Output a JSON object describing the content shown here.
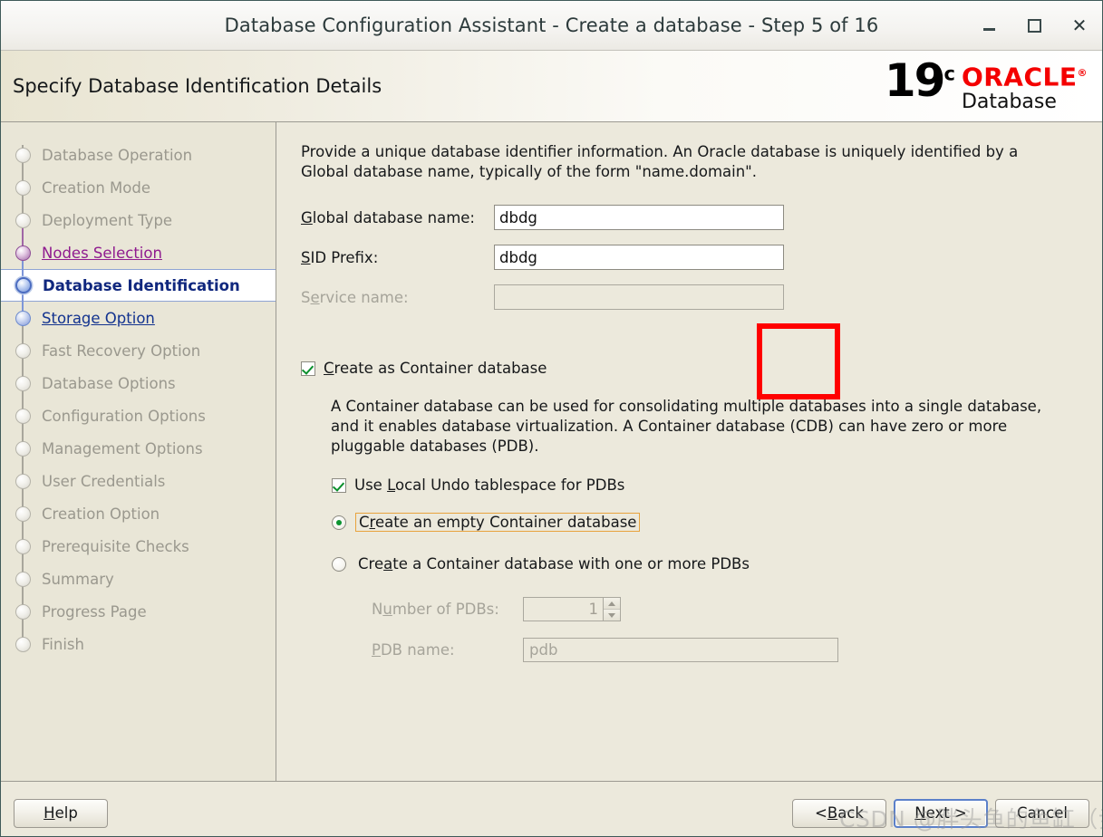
{
  "window": {
    "title": "Database Configuration Assistant - Create a database - Step 5 of 16",
    "minimize_label": "–",
    "maximize_label": "□",
    "close_label": "×"
  },
  "header": {
    "page_title": "Specify Database Identification Details",
    "logo_version": "19",
    "logo_superscript": "c",
    "logo_brand": "ORACLE",
    "logo_product": "Database",
    "brand_color": "#f40000"
  },
  "sidebar": {
    "items": [
      {
        "label": "Database Operation",
        "state": "pending"
      },
      {
        "label": "Creation Mode",
        "state": "pending"
      },
      {
        "label": "Deployment Type",
        "state": "pending"
      },
      {
        "label": "Nodes Selection",
        "state": "nodes"
      },
      {
        "label": "Database Identification",
        "state": "current"
      },
      {
        "label": "Storage Option",
        "state": "visited"
      },
      {
        "label": "Fast Recovery Option",
        "state": "pending"
      },
      {
        "label": "Database Options",
        "state": "pending"
      },
      {
        "label": "Configuration Options",
        "state": "pending"
      },
      {
        "label": "Management Options",
        "state": "pending"
      },
      {
        "label": "User Credentials",
        "state": "pending"
      },
      {
        "label": "Creation Option",
        "state": "pending"
      },
      {
        "label": "Prerequisite Checks",
        "state": "pending"
      },
      {
        "label": "Summary",
        "state": "pending"
      },
      {
        "label": "Progress Page",
        "state": "pending"
      },
      {
        "label": "Finish",
        "state": "pending"
      }
    ]
  },
  "main": {
    "intro_line1": "Provide a unique database identifier information. An Oracle database is uniquely identified by a",
    "intro_line2": "Global database name, typically of the form \"name.domain\".",
    "fields": {
      "global_db_name_label": "Global database name:",
      "global_db_name_value": "dbdg",
      "sid_prefix_label": "SID Prefix:",
      "sid_prefix_value": "dbdg",
      "service_name_label": "Service name:",
      "service_name_value": ""
    },
    "container": {
      "checkbox_label": "Create as Container database",
      "checkbox_checked": true,
      "description_line1": "A Container database can be used for consolidating multiple databases into a single database,",
      "description_line2": "and it enables database virtualization. A Container database (CDB) can have zero or more",
      "description_line3": "pluggable databases (PDB).",
      "local_undo_label": "Use Local Undo tablespace for PDBs",
      "local_undo_checked": true,
      "radio_empty_label": "Create an empty Container database",
      "radio_empty_selected": true,
      "radio_pdbs_label": "Create a Container database with one or more PDBs",
      "radio_pdbs_selected": false,
      "num_pdbs_label": "Number of PDBs:",
      "num_pdbs_value": "1",
      "pdb_name_label": "PDB name:",
      "pdb_name_value": "pdb"
    },
    "annotation_color": "#ff0000"
  },
  "footer": {
    "help_label": "Help",
    "back_label": "< Back",
    "next_label": "Next >",
    "cancel_label": "Cancel",
    "watermark": "CSDN @胖头鱼的鱼缸（尹海文）"
  }
}
